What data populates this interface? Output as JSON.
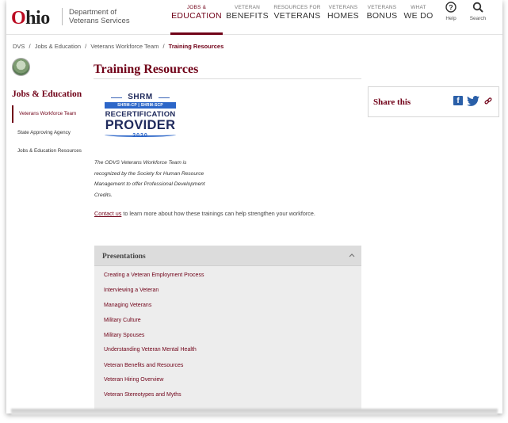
{
  "header": {
    "logo": {
      "o": "O",
      "rest": "hio"
    },
    "dept": [
      "Department of",
      "Veterans Services"
    ],
    "nav": [
      {
        "small": "JOBS &",
        "big": "EDUCATION",
        "active": true
      },
      {
        "small": "VETERAN",
        "big": "BENEFITS",
        "active": false
      },
      {
        "small": "RESOURCES FOR",
        "big": "VETERANS",
        "active": false
      },
      {
        "small": "VETERANS",
        "big": "HOMES",
        "active": false
      },
      {
        "small": "VETERANS",
        "big": "BONUS",
        "active": false
      },
      {
        "small": "WHAT",
        "big": "WE DO",
        "active": false
      }
    ],
    "help": {
      "icon": "help-icon",
      "label": "Help"
    },
    "search": {
      "icon": "search-icon",
      "label": "Search"
    }
  },
  "breadcrumb": [
    {
      "label": "DVS"
    },
    {
      "label": "/"
    },
    {
      "label": "Jobs & Education"
    },
    {
      "label": "/"
    },
    {
      "label": "Veterans Workforce Team"
    },
    {
      "label": "/"
    },
    {
      "label": "Training Resources"
    }
  ],
  "sidebar": {
    "title": "Jobs & Education",
    "items": [
      {
        "label": "Veterans Workforce Team",
        "active": true
      },
      {
        "label": "State Approving Agency",
        "active": false
      },
      {
        "label": "Jobs & Education Resources",
        "active": false
      }
    ]
  },
  "main": {
    "title": "Training Resources",
    "badge": {
      "shrm": "SHRM",
      "certs": "SHRM-CP | SHRM-SCP",
      "recert": "RECERTIFICATION",
      "provider": "PROVIDER",
      "year": "2020"
    },
    "description": "The ODVS Veterans Workforce Team is recognized by the Society for Human Resource Management to offer Professional Development Credits.",
    "contact_link": "Contact us",
    "contact_rest": " to learn more about how these trainings can help strengthen your workforce."
  },
  "share": {
    "label": "Share this",
    "icons": [
      "facebook-icon",
      "twitter-icon",
      "link-icon"
    ]
  },
  "accordion": {
    "title": "Presentations",
    "items": [
      "Creating a Veteran Employment Process",
      "Interviewing a Veteran",
      "Managing Veterans",
      "Military Culture",
      "Military Spouses",
      "Understanding Veteran Mental Health",
      "Veteran Benefits and Resources",
      "Veteran Hiring Overview",
      "Veteran Stereotypes and Myths"
    ]
  }
}
